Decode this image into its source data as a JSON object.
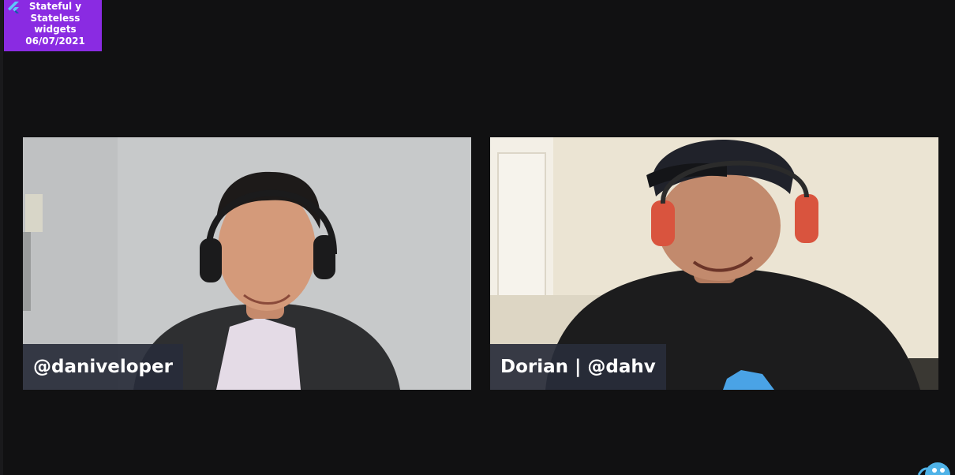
{
  "badge": {
    "icon": "flutter-logo-icon",
    "lines": [
      "Stateful y",
      "Stateless",
      "widgets",
      "06/07/2021"
    ],
    "color": "#8a2be2"
  },
  "participants": [
    {
      "name": "@daniveloper"
    },
    {
      "name": "Dorian | @dahv"
    }
  ],
  "colors": {
    "background": "#111112",
    "name_plate": "#282c3a"
  },
  "corner_icon": "mascot-icon"
}
